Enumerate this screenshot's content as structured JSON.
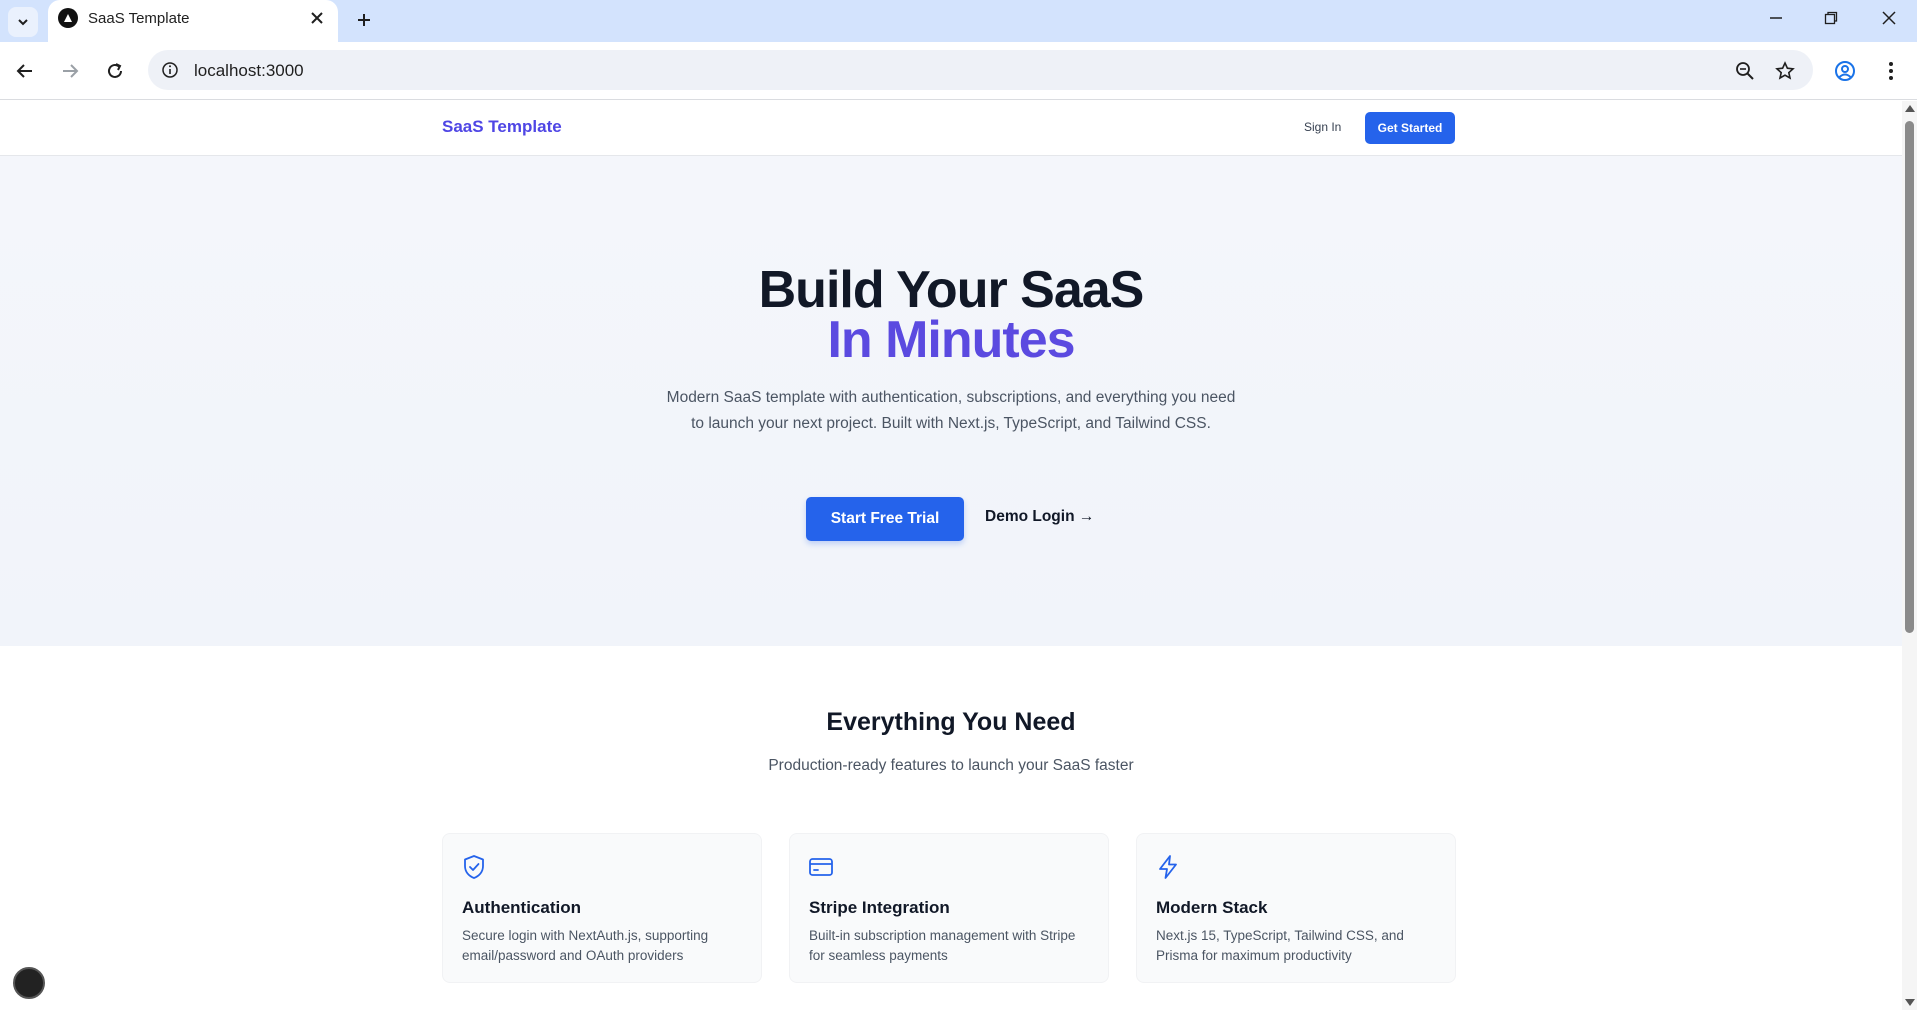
{
  "browser": {
    "tab_title": "SaaS Template",
    "url": "localhost:3000"
  },
  "site": {
    "brand": "SaaS Template",
    "nav": {
      "sign_in": "Sign In",
      "get_started": "Get Started"
    },
    "hero": {
      "title_line1": "Build Your SaaS",
      "title_line2": "In Minutes",
      "description": "Modern SaaS template with authentication, subscriptions, and everything you need to launch your next project. Built with Next.js, TypeScript, and Tailwind CSS.",
      "primary_cta": "Start Free Trial",
      "secondary_cta": "Demo Login →"
    },
    "features": {
      "title": "Everything You Need",
      "subtitle": "Production-ready features to launch your SaaS faster",
      "cards": [
        {
          "icon": "shield-check-icon",
          "title": "Authentication",
          "description": "Secure login with NextAuth.js, supporting email/password and OAuth providers"
        },
        {
          "icon": "credit-card-icon",
          "title": "Stripe Integration",
          "description": "Built-in subscription management with Stripe for seamless payments"
        },
        {
          "icon": "lightning-bolt-icon",
          "title": "Modern Stack",
          "description": "Next.js 15, TypeScript, Tailwind CSS, and Prisma for maximum productivity"
        }
      ]
    }
  },
  "colors": {
    "brand": "#4f46e5",
    "accent_purple": "#5b4ae0",
    "primary_button": "#2563eb",
    "tab_strip": "#d3e3fd"
  }
}
